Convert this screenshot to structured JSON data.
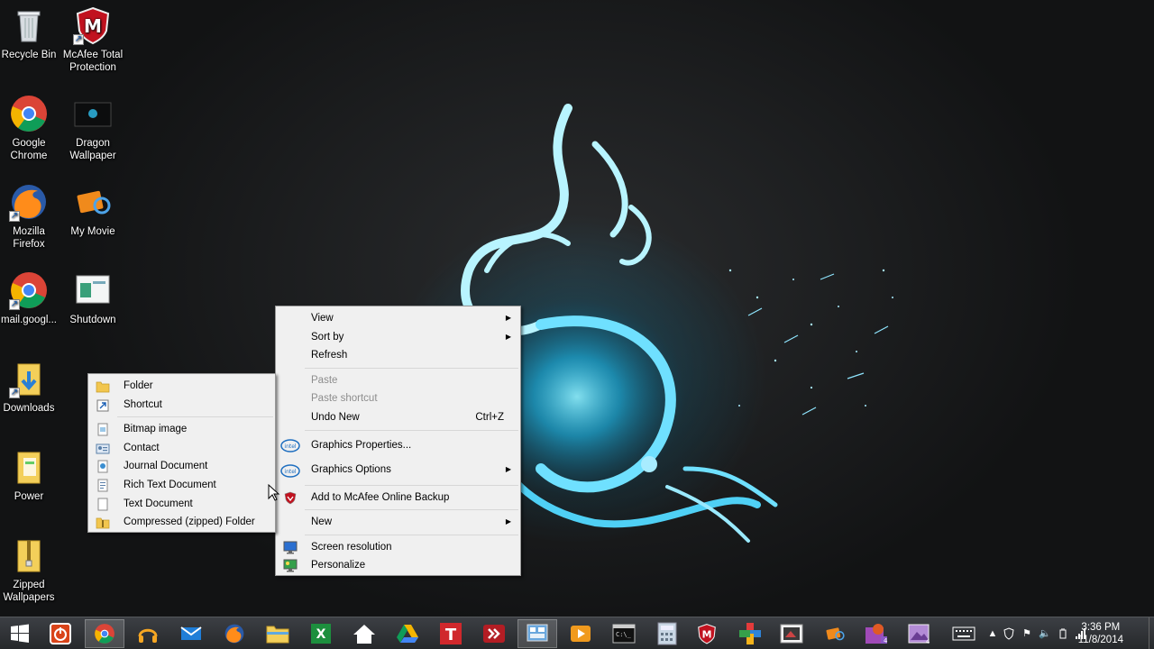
{
  "desktop": {
    "icons": [
      {
        "label": "Recycle Bin",
        "icon": "recycle-bin-icon"
      },
      {
        "label": "McAfee Total Protection",
        "icon": "mcafee-icon"
      },
      {
        "label": "Google Chrome",
        "icon": "chrome-icon"
      },
      {
        "label": "Dragon Wallpaper",
        "icon": "image-thumbnail-icon"
      },
      {
        "label": "Mozilla Firefox",
        "icon": "firefox-icon"
      },
      {
        "label": "My Movie",
        "icon": "movie-maker-icon"
      },
      {
        "label": "mail.googl...",
        "icon": "chrome-icon"
      },
      {
        "label": "Shutdown",
        "icon": "shutdown-shortcut-icon"
      },
      {
        "label": "Downloads",
        "icon": "downloads-folder-icon"
      },
      {
        "label": "Power",
        "icon": "folder-icon"
      },
      {
        "label": "Zipped Wallpapers",
        "icon": "zipped-folder-icon"
      }
    ]
  },
  "context_menu": {
    "view": "View",
    "sort_by": "Sort by",
    "refresh": "Refresh",
    "paste": "Paste",
    "paste_shortcut": "Paste shortcut",
    "undo_new": "Undo New",
    "undo_new_key": "Ctrl+Z",
    "graphics_properties": "Graphics Properties...",
    "graphics_options": "Graphics Options",
    "mcafee_backup": "Add to McAfee Online Backup",
    "new": "New",
    "screen_resolution": "Screen resolution",
    "personalize": "Personalize"
  },
  "new_submenu": {
    "folder": "Folder",
    "shortcut": "Shortcut",
    "bitmap": "Bitmap image",
    "contact": "Contact",
    "journal": "Journal Document",
    "rtf": "Rich Text Document",
    "text": "Text Document",
    "zip": "Compressed (zipped) Folder"
  },
  "taskbar": {
    "clock_time": "3:36 PM",
    "clock_date": "11/8/2014",
    "pinned": [
      "windows-start-icon",
      "shutdown-icon",
      "chrome-icon",
      "headphones-icon",
      "mail-icon",
      "firefox-icon",
      "file-explorer-icon",
      "excel-icon",
      "home-icon",
      "google-drive-icon",
      "text-tool-icon",
      "fast-forward-icon",
      "control-panel-icon",
      "video-player-icon",
      "command-prompt-icon",
      "calculator-icon",
      "mcafee-icon",
      "plus-icon",
      "photo-icon",
      "movie-maker-icon",
      "paint-icon",
      "photo-editor-icon"
    ]
  },
  "colors": {
    "menu_bg": "#f0f0f0",
    "taskbar_bg": "#2e3034",
    "dragon_glow": "#29c5f6"
  }
}
